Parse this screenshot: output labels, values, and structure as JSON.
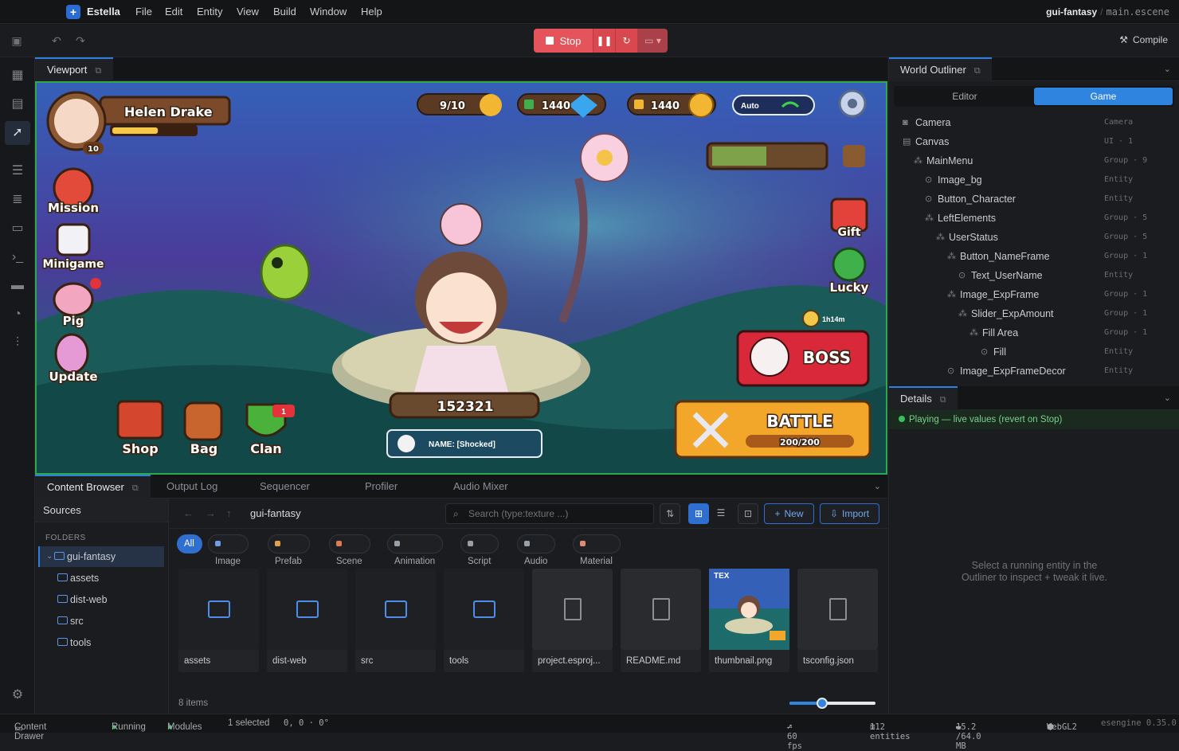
{
  "app": {
    "name": "Estella",
    "project": "gui-fantasy",
    "scene": "main.escene"
  },
  "menu": [
    "File",
    "Edit",
    "Entity",
    "View",
    "Build",
    "Window",
    "Help"
  ],
  "toolbar": {
    "stop_label": "Stop",
    "compile_label": "Compile"
  },
  "viewport": {
    "tab_label": "Viewport",
    "game": {
      "player_name": "Helen Drake",
      "player_level": "10",
      "exp_fraction": 0.55,
      "energy": "9/10",
      "gems": "1440",
      "gold": "1440",
      "auto_label": "Auto",
      "left_buttons": [
        "Mission",
        "Minigame",
        "Pig",
        "Update"
      ],
      "bottom_buttons": [
        "Shop",
        "Bag",
        "Clan"
      ],
      "clan_badge": "1",
      "right_buttons": [
        "Gift",
        "Lucky"
      ],
      "timer": "1h14m",
      "boss_label": "BOSS",
      "power": "152321",
      "chat_text": "NAME: [Shocked]",
      "battle_label": "BATTLE",
      "battle_energy": "200/200"
    }
  },
  "outliner": {
    "title": "World Outliner",
    "tabs": [
      "Editor",
      "Game"
    ],
    "active_tab": "Game",
    "rows": [
      {
        "name": "Camera",
        "type": "Camera",
        "depth": 0,
        "icon": "camera-icon"
      },
      {
        "name": "Canvas",
        "type": "UI · 1",
        "depth": 0,
        "icon": "canvas-icon"
      },
      {
        "name": "MainMenu",
        "type": "Group · 9",
        "depth": 1,
        "icon": "group-icon"
      },
      {
        "name": "Image_bg",
        "type": "Entity",
        "depth": 2,
        "icon": "entity-icon"
      },
      {
        "name": "Button_Character",
        "type": "Entity",
        "depth": 2,
        "icon": "entity-icon"
      },
      {
        "name": "LeftElements",
        "type": "Group · 5",
        "depth": 2,
        "icon": "group-icon"
      },
      {
        "name": "UserStatus",
        "type": "Group · 5",
        "depth": 3,
        "icon": "group-icon"
      },
      {
        "name": "Button_NameFrame",
        "type": "Group · 1",
        "depth": 4,
        "icon": "group-icon"
      },
      {
        "name": "Text_UserName",
        "type": "Entity",
        "depth": 5,
        "icon": "entity-icon"
      },
      {
        "name": "Image_ExpFrame",
        "type": "Group · 1",
        "depth": 4,
        "icon": "group-icon"
      },
      {
        "name": "Slider_ExpAmount",
        "type": "Group · 1",
        "depth": 5,
        "icon": "group-icon"
      },
      {
        "name": "Fill Area",
        "type": "Group · 1",
        "depth": 6,
        "icon": "group-icon"
      },
      {
        "name": "Fill",
        "type": "Entity",
        "depth": 7,
        "icon": "entity-icon"
      },
      {
        "name": "Image_ExpFrameDecor",
        "type": "Entity",
        "depth": 4,
        "icon": "entity-icon"
      }
    ]
  },
  "details": {
    "title": "Details",
    "playing_text": "Playing — live values (revert on Stop)",
    "hint_line1": "Select a running entity in the",
    "hint_line2": "Outliner to inspect + tweak it live."
  },
  "bottom_tabs": [
    "Content Browser",
    "Output Log",
    "Sequencer",
    "Profiler",
    "Audio Mixer"
  ],
  "sources": {
    "title": "Sources",
    "folders_label": "FOLDERS",
    "folders": [
      {
        "name": "gui-fantasy",
        "selected": true,
        "depth": 0
      },
      {
        "name": "assets",
        "selected": false,
        "depth": 1
      },
      {
        "name": "dist-web",
        "selected": false,
        "depth": 1
      },
      {
        "name": "src",
        "selected": false,
        "depth": 1
      },
      {
        "name": "tools",
        "selected": false,
        "depth": 1
      }
    ]
  },
  "content": {
    "breadcrumb": "gui-fantasy",
    "search_placeholder": "Search (type:texture ...)",
    "new_label": "New",
    "import_label": "Import",
    "filters": [
      {
        "label": "All",
        "color": "",
        "active": true
      },
      {
        "label": "Image",
        "color": "#6f9be8"
      },
      {
        "label": "Prefab",
        "color": "#e0a050"
      },
      {
        "label": "Scene",
        "color": "#e07a50"
      },
      {
        "label": "Animation",
        "color": "#9aa0a8"
      },
      {
        "label": "Script",
        "color": "#9aa0a8"
      },
      {
        "label": "Audio",
        "color": "#9aa0a8"
      },
      {
        "label": "Material",
        "color": "#e08a70"
      }
    ],
    "items": [
      {
        "name": "assets",
        "kind": "folder"
      },
      {
        "name": "dist-web",
        "kind": "folder"
      },
      {
        "name": "src",
        "kind": "folder"
      },
      {
        "name": "tools",
        "kind": "folder"
      },
      {
        "name": "project.esproj...",
        "kind": "file"
      },
      {
        "name": "README.md",
        "kind": "file"
      },
      {
        "name": "thumbnail.png",
        "kind": "image",
        "badge": "TEX"
      },
      {
        "name": "tsconfig.json",
        "kind": "file"
      }
    ],
    "count_label": "8 items",
    "zoom_fraction": 0.38
  },
  "status": {
    "drawer": "Content Drawer",
    "running": "Running",
    "modules": "Modules",
    "selected": "1 selected",
    "coords": "0, 0 · 0°",
    "fps": "— 60 fps",
    "entities": "112 entities",
    "memory": "15.2 /64.0 MB",
    "renderer": "WebGL2",
    "version": "esengine 0.35.0"
  },
  "colors": {
    "accent": "#2f7fe0",
    "stop": "#e5545b",
    "play_green": "#3bbf5c"
  }
}
